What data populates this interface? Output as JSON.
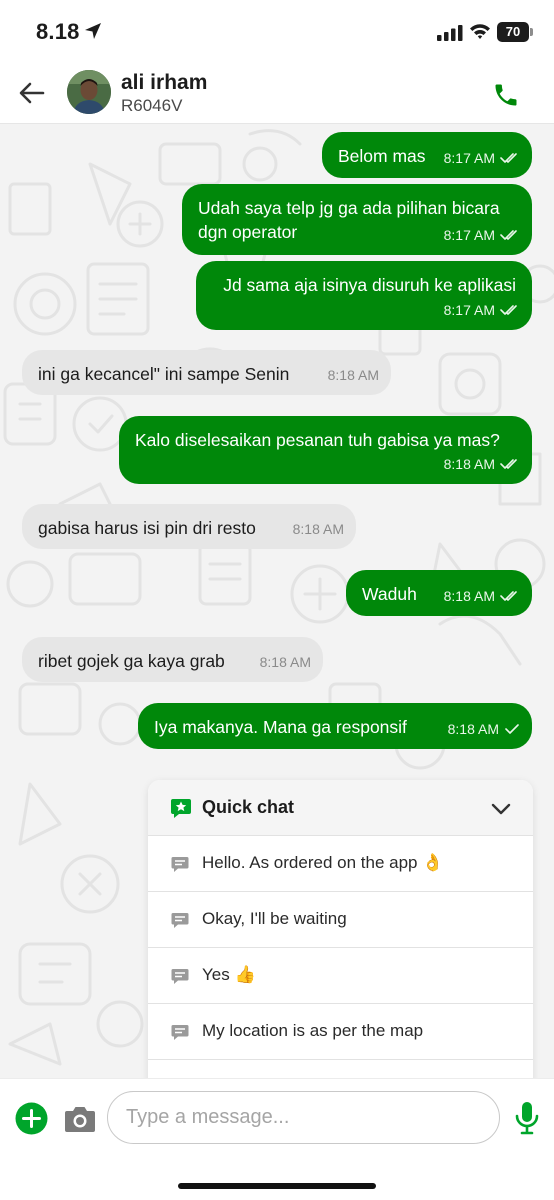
{
  "status_bar": {
    "time": "8.18",
    "battery": "70"
  },
  "header": {
    "name": "ali irham",
    "id": "R6046V"
  },
  "colors": {
    "brand_green": "#00880a",
    "incoming_bubble": "#e6e6e6"
  },
  "messages": [
    {
      "dir": "out",
      "text": "Belom mas",
      "time": "8:17 AM",
      "status": "read"
    },
    {
      "dir": "out",
      "text": "Udah saya telp jg ga ada pilihan bicara dgn operator",
      "time": "8:17 AM",
      "status": "read"
    },
    {
      "dir": "out",
      "text": "Jd sama aja isinya disuruh ke aplikasi",
      "time": "8:17 AM",
      "status": "read"
    },
    {
      "dir": "in",
      "text": "ini ga kecancel\" ini sampe Senin",
      "time": "8:18 AM"
    },
    {
      "dir": "out",
      "text": "Kalo diselesaikan pesanan tuh gabisa ya mas?",
      "time": "8:18 AM",
      "status": "read"
    },
    {
      "dir": "in",
      "text": "gabisa harus isi pin dri resto",
      "time": "8:18 AM"
    },
    {
      "dir": "out",
      "text": "Waduh",
      "time": "8:18 AM",
      "status": "read"
    },
    {
      "dir": "in",
      "text": "ribet gojek ga kaya grab",
      "time": "8:18 AM"
    },
    {
      "dir": "out",
      "text": "Iya makanya. Mana ga responsif",
      "time": "8:18 AM",
      "status": "sent"
    }
  ],
  "quick_chat": {
    "title": "Quick chat",
    "items": [
      "Hello. As ordered on the app 👌",
      "Okay, I'll be waiting",
      "Yes 👍",
      "My location is as per the map"
    ]
  },
  "input": {
    "placeholder": "Type a message..."
  },
  "icons": {
    "back": "arrow-left-icon",
    "call": "phone-icon",
    "add": "plus-circle-icon",
    "camera": "camera-icon",
    "mic": "microphone-icon",
    "quick_chat": "star-chat-icon",
    "collapse": "chevron-down-icon"
  }
}
